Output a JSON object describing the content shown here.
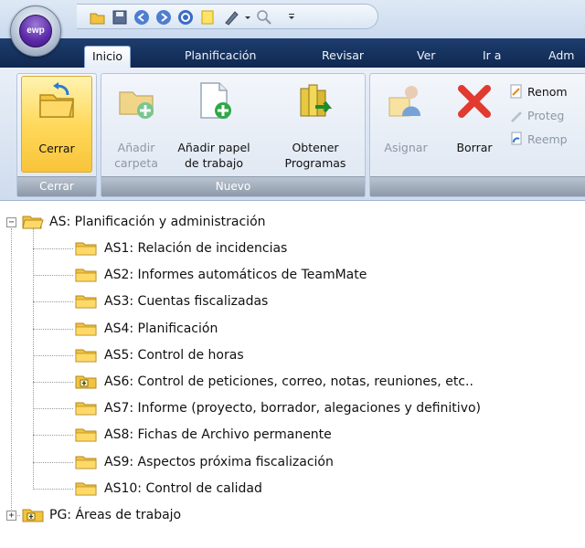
{
  "app": {
    "logo_text": "ewp"
  },
  "tabs": [
    "Inicio",
    "Planificación",
    "Revisar",
    "Ver",
    "Ir a",
    "Adm"
  ],
  "ribbon": {
    "groups": {
      "cerrar": {
        "label": "Cerrar",
        "button": "Cerrar"
      },
      "nuevo": {
        "label": "Nuevo",
        "buttons": {
          "anadir_carpeta": "Añadir carpeta",
          "anadir_papel": "Añadir papel de trabajo",
          "obtener": "Obtener Programas"
        }
      },
      "edit": {
        "asignar": "Asignar",
        "borrar": "Borrar",
        "renombrar": "Renom",
        "proteger": "Proteg",
        "reemplazar": "Reemp"
      }
    }
  },
  "tree": {
    "root": "AS: Planificación y administración",
    "children": [
      "AS1: Relación de incidencias",
      "AS2: Informes automáticos de TeamMate",
      "AS3: Cuentas fiscalizadas",
      "AS4: Planificación",
      "AS5: Control de horas",
      "AS6: Control de peticiones, correo, notas, reuniones, etc..",
      "AS7: Informe (proyecto, borrador, alegaciones y definitivo)",
      "AS8: Fichas de Archivo permanente",
      "AS9: Aspectos próxima fiscalización",
      "AS10: Control de calidad"
    ],
    "second_root": "PG: Áreas de trabajo"
  },
  "colors": {
    "accent": "#0f2850",
    "selected": "#ffd95c",
    "folder": "#f2c340"
  }
}
